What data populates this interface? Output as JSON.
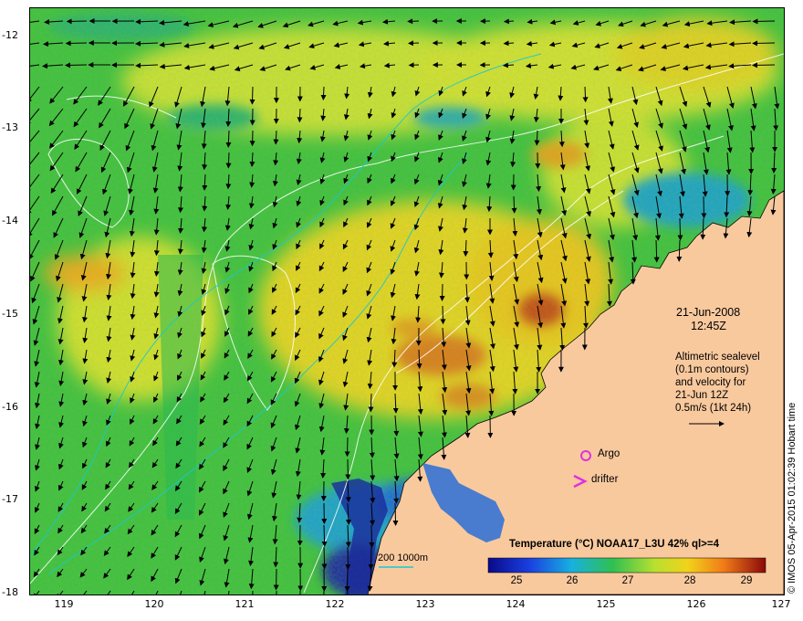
{
  "map": {
    "y_ticks": [
      "-12",
      "-13",
      "-14",
      "-15",
      "-16",
      "-17",
      "-18"
    ],
    "x_ticks": [
      "119",
      "120",
      "121",
      "122",
      "123",
      "124",
      "125",
      "126",
      "127"
    ],
    "lat_range": [
      -18,
      -11.8
    ],
    "lon_range": [
      118.6,
      127
    ],
    "date": "21-Jun-2008",
    "time": "12:45Z",
    "altimetry_lines": [
      "Altimetric sealevel",
      "(0.1m contours)",
      "and velocity for",
      "21-Jun 12Z",
      "0.5m/s (1kt 24h)"
    ],
    "argo_label": "Argo",
    "drifter_label": "drifter",
    "depth_legend": "200  1000m",
    "credit": "© IMOS 05-Apr-2015 01:02:39 Hobart time",
    "colors": {
      "land": "#f9c99e",
      "ocean_warm": "#f2c21a",
      "ocean_green": "#3fbf3f",
      "argo_drifter": "#e030e0",
      "depth_contour": "#19c8d0"
    }
  },
  "colorbar": {
    "title": "Temperature (°C) NOAA17_L3U 42% ql>=4",
    "ticks": [
      "25",
      "26",
      "27",
      "28",
      "29"
    ],
    "range": [
      24.4,
      29.4
    ]
  }
}
